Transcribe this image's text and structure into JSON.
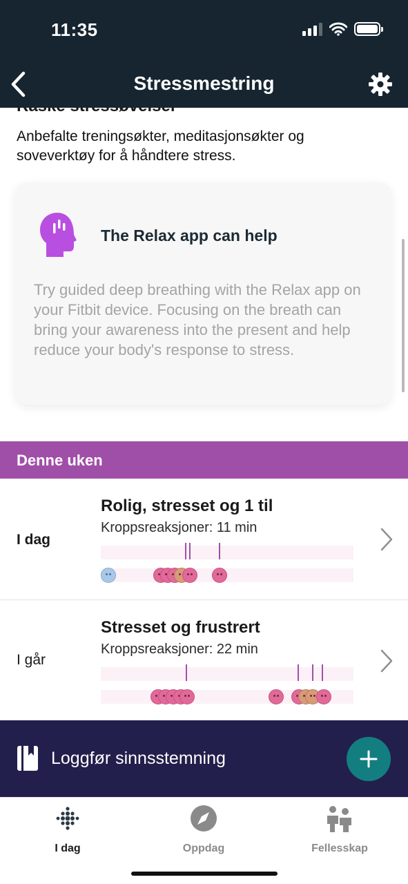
{
  "status_bar": {
    "time": "11:35"
  },
  "header": {
    "title": "Stressmestring"
  },
  "section": {
    "heading": "Raske stressøvelser",
    "description": "Anbefalte treningsøkter, meditasjonsøkter og soveverktøy for å håndtere stress."
  },
  "relax_card": {
    "title": "The Relax app can help",
    "body": "Try guided deep breathing with the Relax app on your Fitbit device. Focusing on the breath can bring your awareness into the present and help reduce your body's response to stress."
  },
  "week": {
    "header": "Denne uken",
    "days": [
      {
        "label": "I dag",
        "title": "Rolig, stresset og 1 til",
        "subtitle": "Kroppsreaksjoner: 11 min"
      },
      {
        "label": "I går",
        "title": "Stresset og frustrert",
        "subtitle": "Kroppsreaksjoner: 22 min"
      }
    ]
  },
  "log_mood": {
    "label": "Loggfør sinnsstemning"
  },
  "bottom_nav": {
    "items": [
      {
        "label": "I dag",
        "icon": "fitbit-dots-icon",
        "active": true
      },
      {
        "label": "Oppdag",
        "icon": "compass-icon",
        "active": false
      },
      {
        "label": "Fellesskap",
        "icon": "community-icon",
        "active": false
      }
    ]
  },
  "colors": {
    "header_bg": "#162530",
    "accent_purple": "#a04fa8",
    "relax_icon": "#b94fe0",
    "log_bar_bg": "#231f4c",
    "add_button": "#137e80",
    "stress_face": "#e06a9a",
    "calm_face": "#a8c8e8"
  }
}
